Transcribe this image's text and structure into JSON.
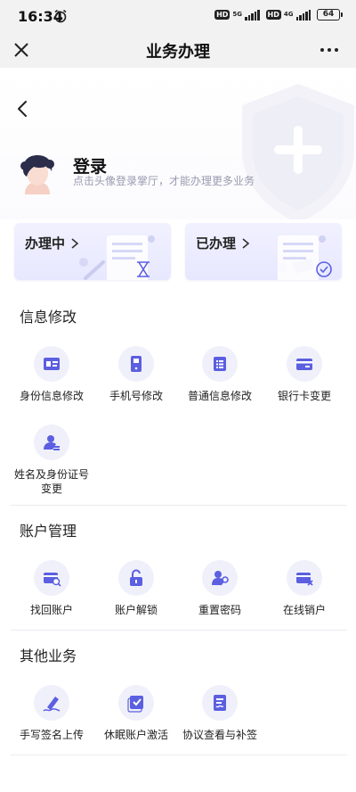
{
  "status_bar": {
    "time": "16:34",
    "hd1": "HD",
    "net1": "5G",
    "hd2": "HD",
    "net2": "4G",
    "battery": "64"
  },
  "nav": {
    "title": "业务办理"
  },
  "login": {
    "title": "登录",
    "subtitle": "点击头像登录掌厅，才能办理更多业务"
  },
  "cards": [
    {
      "label": "办理中"
    },
    {
      "label": "已办理"
    }
  ],
  "sections": [
    {
      "title": "信息修改",
      "items": [
        {
          "label": "身份信息修改",
          "icon": "id-card-icon"
        },
        {
          "label": "手机号修改",
          "icon": "phone-icon"
        },
        {
          "label": "普通信息修改",
          "icon": "list-doc-icon"
        },
        {
          "label": "银行卡变更",
          "icon": "bank-card-icon"
        },
        {
          "label_line1": "姓名及身份证号",
          "label_line2": "变更",
          "icon": "user-edit-icon"
        }
      ]
    },
    {
      "title": "账户管理",
      "items": [
        {
          "label": "找回账户",
          "icon": "card-find-icon"
        },
        {
          "label": "账户解锁",
          "icon": "unlock-icon"
        },
        {
          "label": "重置密码",
          "icon": "user-key-icon"
        },
        {
          "label": "在线销户",
          "icon": "card-cancel-icon"
        }
      ]
    },
    {
      "title": "其他业务",
      "items": [
        {
          "label": "手写签名上传",
          "icon": "signature-icon"
        },
        {
          "label": "休眠账户激活",
          "icon": "check-doc-icon"
        },
        {
          "label": "协议查看与补签",
          "icon": "agreement-icon"
        }
      ]
    }
  ],
  "colors": {
    "accent": "#5b5fe0",
    "icon_bg": "#f0f0fb",
    "card_bg": "#e9eaff"
  }
}
